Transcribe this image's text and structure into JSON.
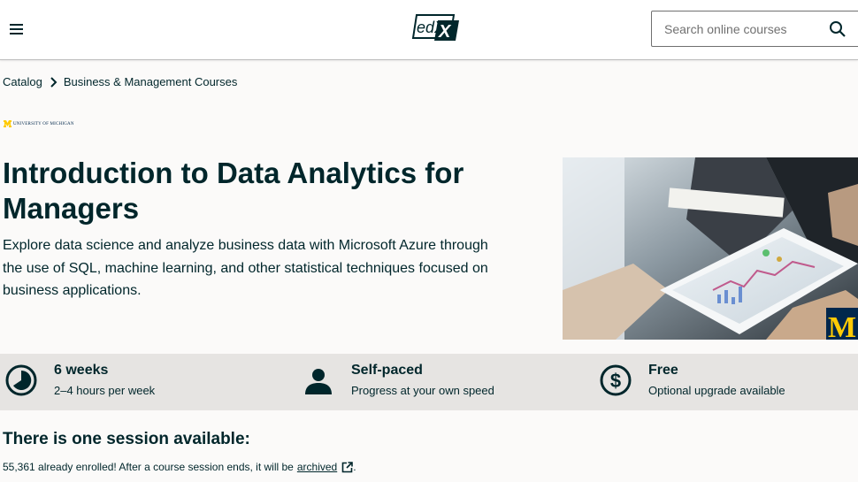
{
  "header": {
    "logo_text": "edX",
    "search_placeholder": "Search online courses",
    "brand_color": "#00262b"
  },
  "breadcrumb": {
    "items": [
      "Catalog",
      "Business & Management Courses"
    ]
  },
  "university": {
    "name": "UNIVERSITY OF MICHIGAN",
    "brand_color": "#ffcb05"
  },
  "course": {
    "title": "Introduction to Data Analytics for Managers",
    "description": "Explore data science and analyze business data with Microsoft Azure through the use of SQL, machine learning, and other statistical techniques focused on business applications.",
    "image_alt": "M"
  },
  "info": [
    {
      "icon": "clock-icon",
      "title": "6 weeks",
      "subtitle": "2–4 hours per week"
    },
    {
      "icon": "person-icon",
      "title": "Self-paced",
      "subtitle": "Progress at your own speed"
    },
    {
      "icon": "dollar-icon",
      "title": "Free",
      "subtitle": "Optional upgrade available"
    }
  ],
  "sessions": {
    "heading": "There is one session available:",
    "enrolled_text": "55,361 already enrolled! After a course session ends, it will be",
    "archived_link": "archived",
    "period": "."
  }
}
